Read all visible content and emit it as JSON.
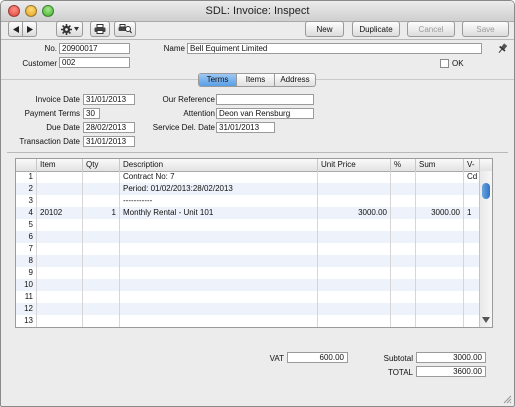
{
  "window": {
    "title": "SDL: Invoice: Inspect"
  },
  "toolbar": {
    "new": "New",
    "duplicate": "Duplicate",
    "cancel": "Cancel",
    "save": "Save"
  },
  "header": {
    "no_label": "No.",
    "no_value": "20900017",
    "name_label": "Name",
    "name_value": "Bell Equiment Limited",
    "customer_label": "Customer",
    "customer_value": "002",
    "ok_label": "OK"
  },
  "tabs": [
    "Terms",
    "Items",
    "Address"
  ],
  "terms": {
    "invoice_date_label": "Invoice Date",
    "invoice_date": "31/01/2013",
    "payment_terms_label": "Payment Terms",
    "payment_terms": "30",
    "due_date_label": "Due Date",
    "due_date": "28/02/2013",
    "transaction_date_label": "Transaction Date",
    "transaction_date": "31/01/2013",
    "our_reference_label": "Our Reference",
    "our_reference": "",
    "attention_label": "Attention",
    "attention": "Deon van Rensburg",
    "service_del_date_label": "Service Del. Date",
    "service_del_date": "31/01/2013"
  },
  "grid": {
    "columns": [
      "Item",
      "Qty",
      "Description",
      "Unit Price",
      "%",
      "Sum",
      "V-Cd"
    ],
    "rows": [
      {
        "n": "1",
        "item": "",
        "qty": "",
        "desc": "Contract No: 7",
        "price": "",
        "pct": "",
        "sum": "",
        "vcd": ""
      },
      {
        "n": "2",
        "item": "",
        "qty": "",
        "desc": "Period: 01/02/2013:28/02/2013",
        "price": "",
        "pct": "",
        "sum": "",
        "vcd": ""
      },
      {
        "n": "3",
        "item": "",
        "qty": "",
        "desc": "-----------",
        "price": "",
        "pct": "",
        "sum": "",
        "vcd": ""
      },
      {
        "n": "4",
        "item": "20102",
        "qty": "1",
        "desc": "Monthly Rental - Unit 101",
        "price": "3000.00",
        "pct": "",
        "sum": "3000.00",
        "vcd": "1"
      },
      {
        "n": "5",
        "item": "",
        "qty": "",
        "desc": "",
        "price": "",
        "pct": "",
        "sum": "",
        "vcd": ""
      },
      {
        "n": "6",
        "item": "",
        "qty": "",
        "desc": "",
        "price": "",
        "pct": "",
        "sum": "",
        "vcd": ""
      },
      {
        "n": "7",
        "item": "",
        "qty": "",
        "desc": "",
        "price": "",
        "pct": "",
        "sum": "",
        "vcd": ""
      },
      {
        "n": "8",
        "item": "",
        "qty": "",
        "desc": "",
        "price": "",
        "pct": "",
        "sum": "",
        "vcd": ""
      },
      {
        "n": "9",
        "item": "",
        "qty": "",
        "desc": "",
        "price": "",
        "pct": "",
        "sum": "",
        "vcd": ""
      },
      {
        "n": "10",
        "item": "",
        "qty": "",
        "desc": "",
        "price": "",
        "pct": "",
        "sum": "",
        "vcd": ""
      },
      {
        "n": "11",
        "item": "",
        "qty": "",
        "desc": "",
        "price": "",
        "pct": "",
        "sum": "",
        "vcd": ""
      },
      {
        "n": "12",
        "item": "",
        "qty": "",
        "desc": "",
        "price": "",
        "pct": "",
        "sum": "",
        "vcd": ""
      },
      {
        "n": "13",
        "item": "",
        "qty": "",
        "desc": "",
        "price": "",
        "pct": "",
        "sum": "",
        "vcd": ""
      }
    ]
  },
  "footer": {
    "vat_label": "VAT",
    "vat": "600.00",
    "subtotal_label": "Subtotal",
    "subtotal": "3000.00",
    "total_label": "TOTAL",
    "total": "3600.00"
  },
  "colors": {
    "tab_active": "#5a9ee6",
    "scroll_thumb": "#2f73c5",
    "row_alt": "#eef3fb"
  }
}
